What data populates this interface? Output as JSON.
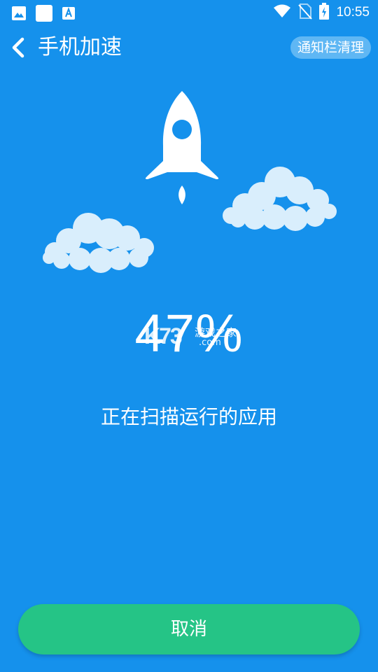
{
  "status_bar": {
    "time": "10:55",
    "icons": [
      "image-icon",
      "blank-square-icon",
      "font-a-icon",
      "wifi-icon",
      "no-sim-icon",
      "battery-charging-icon"
    ]
  },
  "app_bar": {
    "title": "手机加速",
    "notify_button_label": "通知栏清理"
  },
  "progress": {
    "percent_text": "47%",
    "value": 47
  },
  "watermark": {
    "logo": "K73",
    "cn": "游戏之家",
    "en": ".com"
  },
  "scan_status_text": "正在扫描运行的应用",
  "cancel_label": "取消",
  "colors": {
    "background": "#1591ec",
    "cancel_button": "#25c486",
    "cloud": "#d9eefc"
  }
}
